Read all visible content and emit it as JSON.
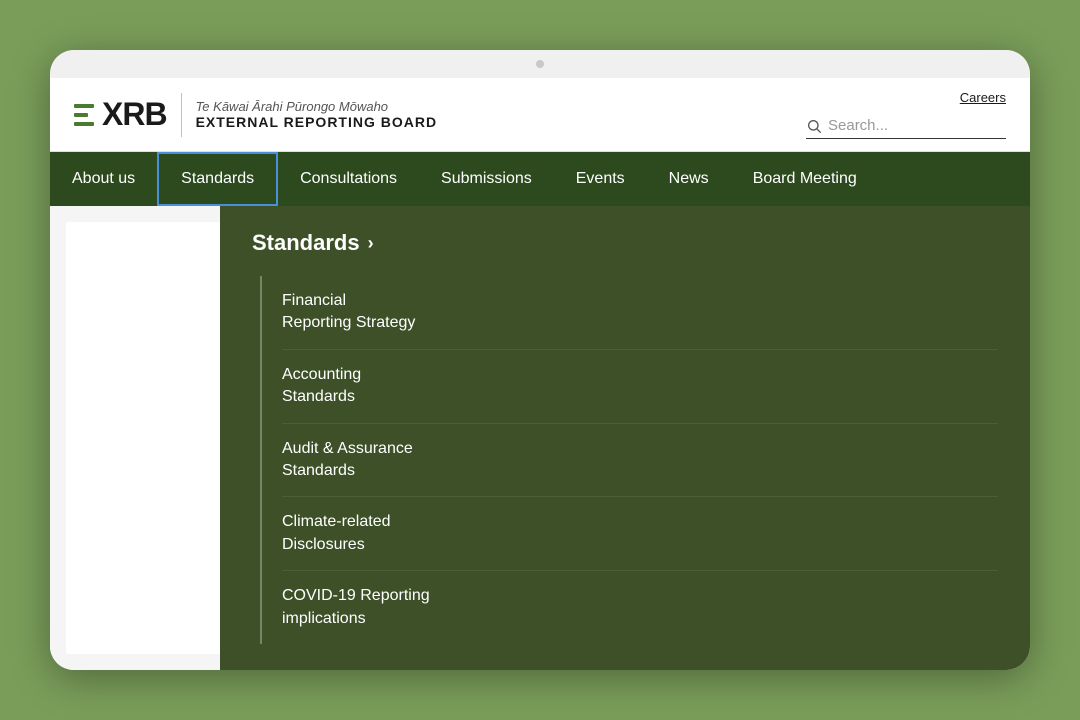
{
  "header": {
    "logo": {
      "xrb_text": "XRB",
      "subtitle_line1": "Te Kāwai Ārahi Pūrongo Mōwaho",
      "subtitle_line2": "EXTERNAL REPORTING BOARD"
    },
    "careers_label": "Careers",
    "search_placeholder": "Search..."
  },
  "nav": {
    "items": [
      {
        "label": "About us",
        "active": false
      },
      {
        "label": "Standards",
        "active": true
      },
      {
        "label": "Consultations",
        "active": false
      },
      {
        "label": "Submissions",
        "active": false
      },
      {
        "label": "Events",
        "active": false
      },
      {
        "label": "News",
        "active": false
      },
      {
        "label": "Board Meeting",
        "active": false
      }
    ]
  },
  "dropdown": {
    "title": "Standards",
    "chevron": "›",
    "items": [
      {
        "label": "Financial Reporting Strategy"
      },
      {
        "label": "Accounting Standards"
      },
      {
        "label": "Audit & Assurance Standards"
      },
      {
        "label": "Climate-related Disclosures"
      },
      {
        "label": "COVID-19 Reporting implications"
      }
    ]
  }
}
